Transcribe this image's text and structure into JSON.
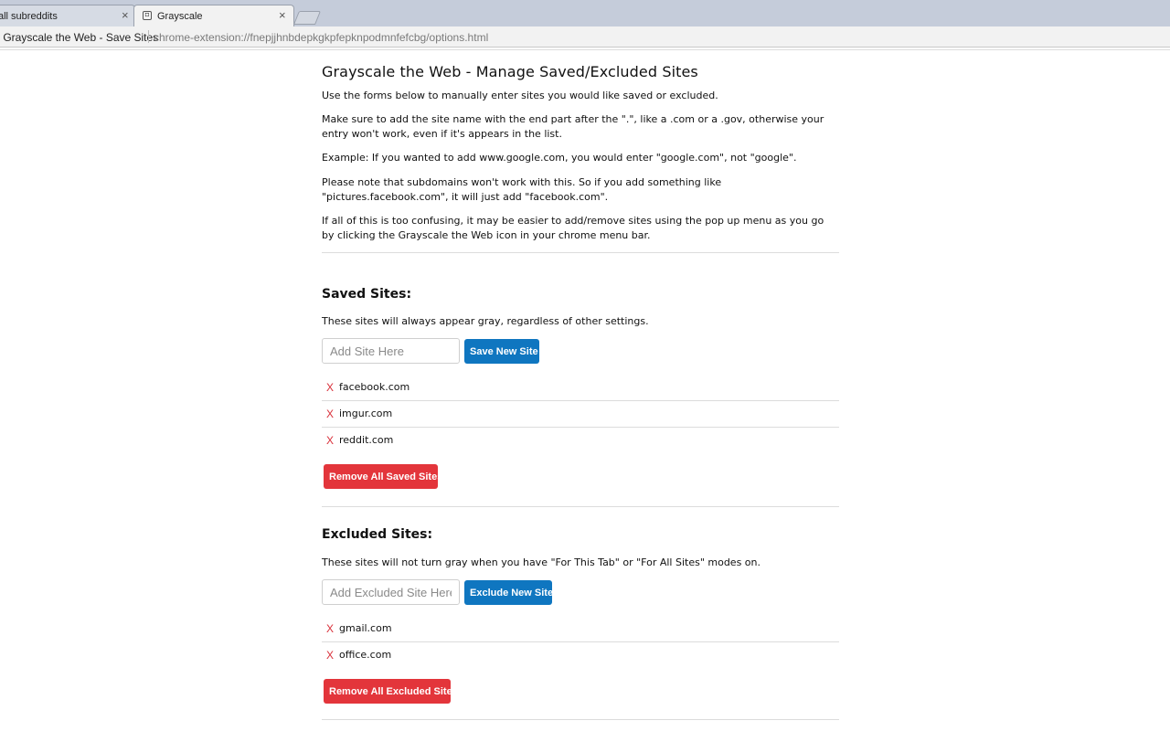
{
  "browser": {
    "tabs": [
      {
        "label": "all subreddits",
        "active": false
      },
      {
        "label": "Grayscale",
        "active": true
      }
    ],
    "omnibox": {
      "title": "- Grayscale the Web - Save Sites",
      "url": "chrome-extension://fnepjjhnbdepkgkpfepknpodmnfefcbg/options.html"
    },
    "close_glyph": "×"
  },
  "page": {
    "title": "Grayscale the Web - Manage Saved/Excluded Sites",
    "intro": [
      "Use the forms below to manually enter sites you would like saved or excluded.",
      "Make sure to add the site name with the end part after the \".\", like a .com or a .gov, otherwise your entry won't work, even if it's appears in the list.",
      "Example: If you wanted to add www.google.com, you would enter \"google.com\", not \"google\".",
      "Please note that subdomains won't work with this. So if you add something like \"pictures.facebook.com\", it will just add \"facebook.com\".",
      "If all of this is too confusing, it may be easier to add/remove sites using the pop up menu as you go by clicking the Grayscale the Web icon in your chrome menu bar."
    ],
    "saved": {
      "heading": "Saved Sites:",
      "description": "These sites will always appear gray, regardless of other settings.",
      "placeholder": "Add Site Here",
      "input_value": "",
      "add_button": "Save New Site",
      "sites": [
        "facebook.com",
        "imgur.com",
        "reddit.com"
      ],
      "remove_all_button": "Remove All Saved Sites"
    },
    "excluded": {
      "heading": "Excluded Sites:",
      "description": "These sites will not turn gray when you have \"For This Tab\" or \"For All Sites\" modes on.",
      "placeholder": "Add Excluded Site Here",
      "input_value": "",
      "add_button": "Exclude New Site",
      "sites": [
        "gmail.com",
        "office.com"
      ],
      "remove_all_button": "Remove All Excluded Sites"
    },
    "remove_glyph": "X"
  },
  "colors": {
    "primary_button": "#0f76c0",
    "danger_button": "#e3353b",
    "remove_x": "#d9303a"
  }
}
